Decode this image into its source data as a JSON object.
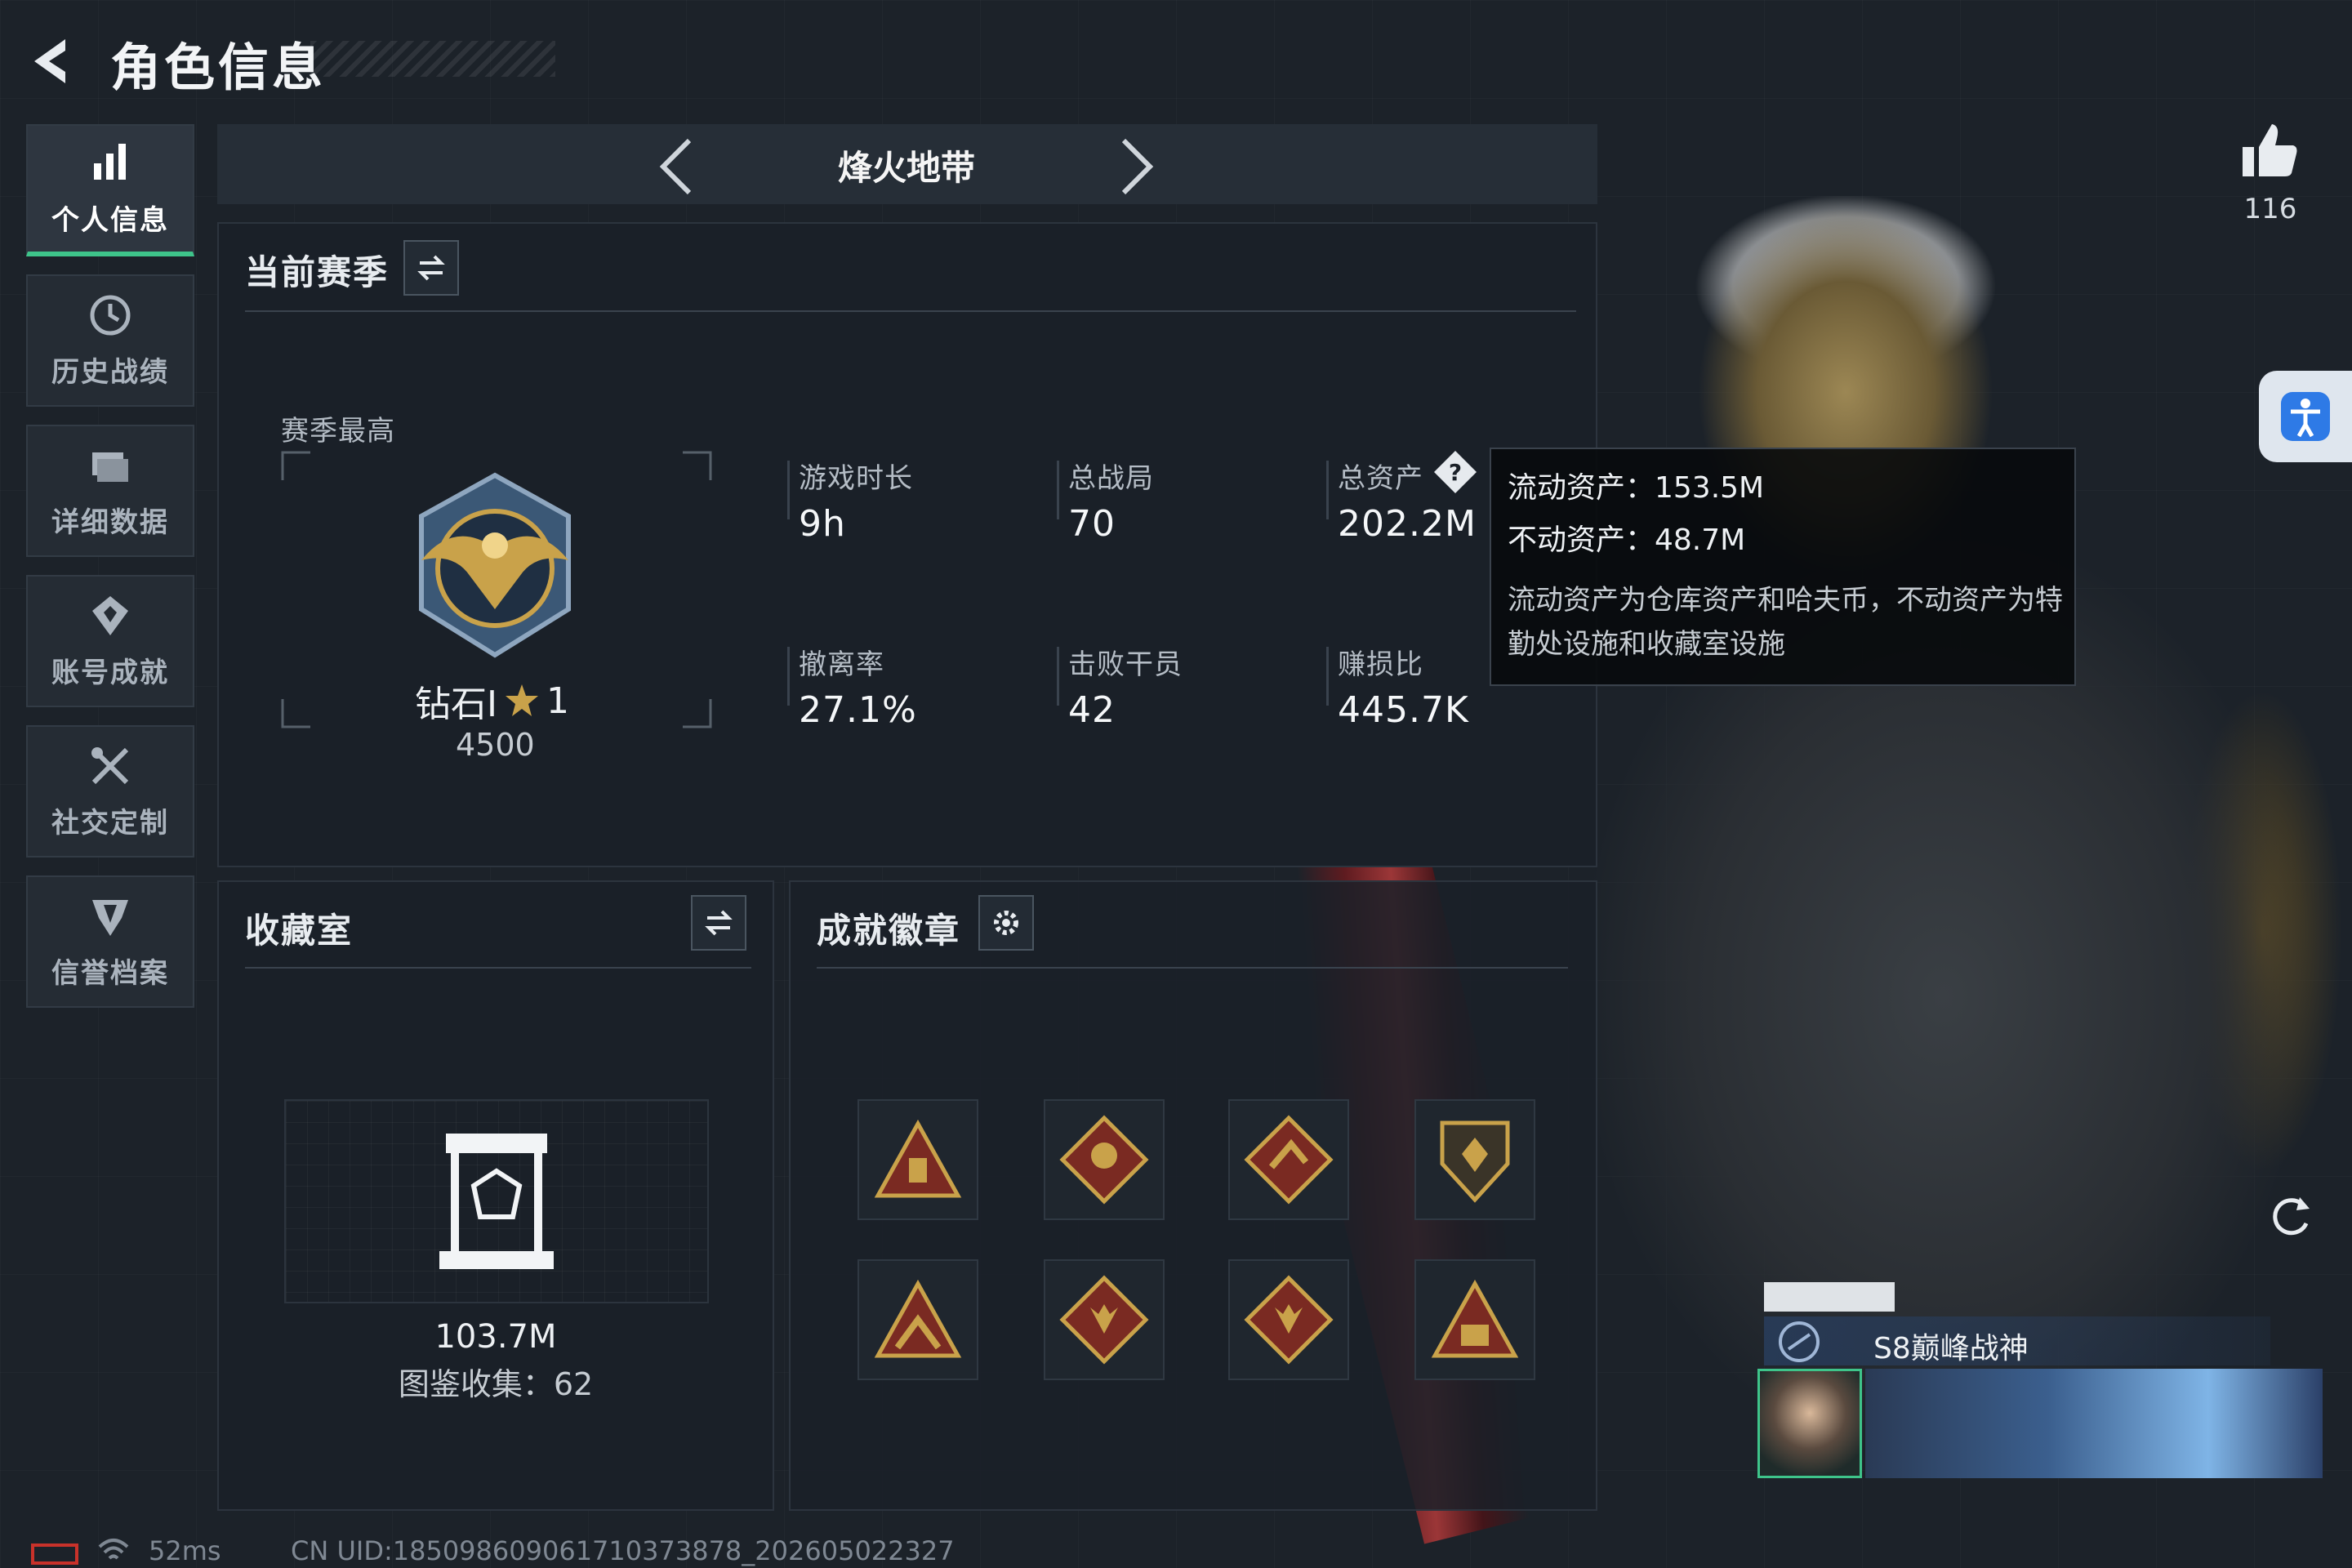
{
  "header": {
    "title": "角色信息"
  },
  "sidebar": {
    "items": [
      {
        "label": "个人信息",
        "icon": "bar-chart-icon",
        "active": true
      },
      {
        "label": "历史战绩",
        "icon": "clock-icon",
        "active": false
      },
      {
        "label": "详细数据",
        "icon": "folder-icon",
        "active": false
      },
      {
        "label": "账号成就",
        "icon": "medal-icon",
        "active": false
      },
      {
        "label": "社交定制",
        "icon": "tools-icon",
        "active": false
      },
      {
        "label": "信誉档案",
        "icon": "shield-icon",
        "active": false
      }
    ]
  },
  "mode": {
    "title": "烽火地带"
  },
  "season": {
    "title": "当前赛季",
    "best_label": "赛季最高",
    "rank_name": "钻石Ⅰ",
    "rank_stars": "1",
    "rank_score": "4500",
    "stats": [
      {
        "label": "游戏时长",
        "value": "9h"
      },
      {
        "label": "总战局",
        "value": "70"
      },
      {
        "label": "总资产",
        "value": "202.2M"
      },
      {
        "label": "撤离率",
        "value": "27.1%"
      },
      {
        "label": "击败干员",
        "value": "42"
      },
      {
        "label": "赚损比",
        "value": "445.7K"
      }
    ]
  },
  "tooltip": {
    "liquid": "流动资产：153.5M",
    "fixed": "不动资产：48.7M",
    "desc": "流动资产为仓库资产和哈夫币，不动资产为特勤处设施和收藏室设施"
  },
  "collection": {
    "title": "收藏室",
    "value": "103.7M",
    "count_text": "图鉴收集：62"
  },
  "achievements": {
    "title": "成就徽章"
  },
  "likes": {
    "count": "116"
  },
  "card": {
    "title": "S8巅峰战神"
  },
  "status": {
    "ping": "52ms",
    "uid": "CN UID:18509860906171037387​8_202605022327"
  },
  "colors": {
    "accent_green": "#3ec48a",
    "gold": "#c9a24a",
    "badge_red": "#7a2a22"
  }
}
